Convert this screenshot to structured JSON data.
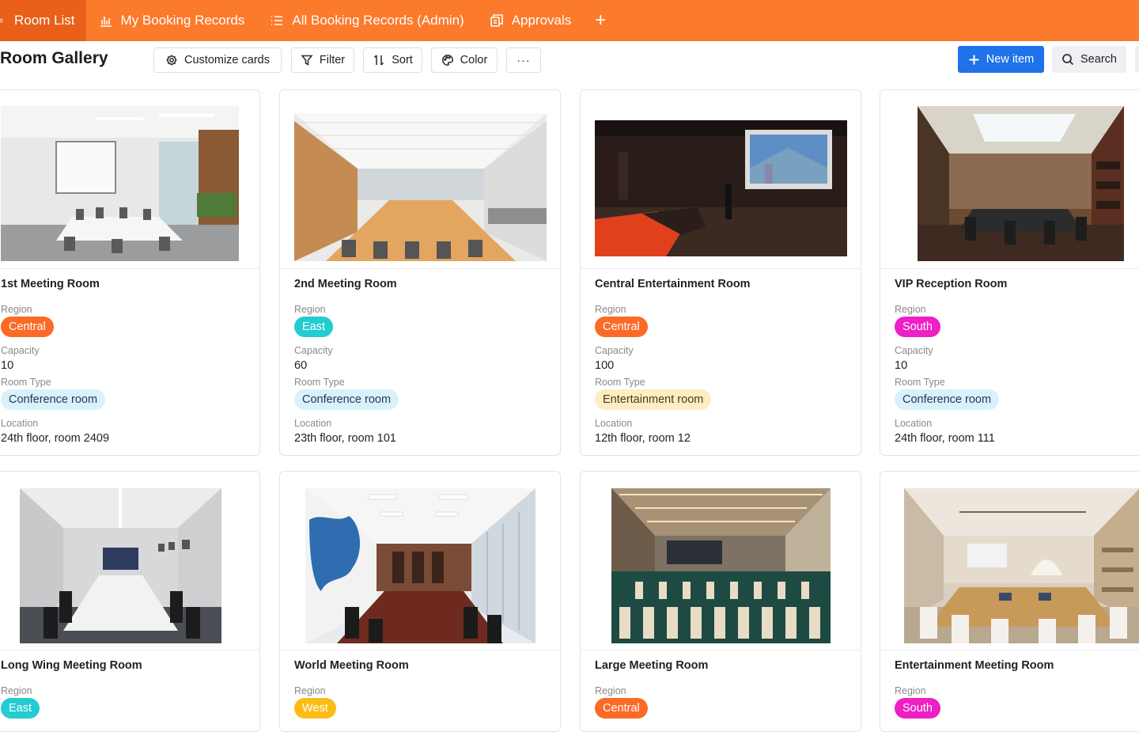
{
  "tabs": [
    {
      "label": "Room List",
      "icon": "menu-icon",
      "active": true
    },
    {
      "label": "My Booking Records",
      "icon": "bar-chart-icon",
      "active": false
    },
    {
      "label": "All Booking Records (Admin)",
      "icon": "list-icon",
      "active": false
    },
    {
      "label": "Approvals",
      "icon": "copy-icon",
      "active": false
    }
  ],
  "tab_add_label": "+",
  "toolbar": {
    "title": "Room Gallery",
    "customize_label": "Customize cards",
    "filter_label": "Filter",
    "sort_label": "Sort",
    "color_label": "Color",
    "more_label": "···",
    "new_item_label": "New item",
    "search_label": "Search"
  },
  "fields": {
    "region": "Region",
    "capacity": "Capacity",
    "room_type": "Room Type",
    "location": "Location"
  },
  "colors": {
    "accent_orange": "#fc7a2c",
    "primary_blue": "#1f72e8",
    "region_central": "#fb6a26",
    "region_east": "#23ccd1",
    "region_south": "#ee1fc5",
    "region_west": "#fcbc16",
    "type_conference_bg": "#d9f1fb",
    "type_entertainment_bg": "#fdedc3"
  },
  "cards": [
    {
      "title": "1st Meeting Room",
      "region": "Central",
      "capacity": "10",
      "room_type": "Conference room",
      "location": "24th floor, room 2409"
    },
    {
      "title": "2nd Meeting Room",
      "region": "East",
      "capacity": "60",
      "room_type": "Conference room",
      "location": "23th floor, room 101"
    },
    {
      "title": "Central Entertainment Room",
      "region": "Central",
      "capacity": "100",
      "room_type": "Entertainment room",
      "location": "12th floor, room 12"
    },
    {
      "title": "VIP Reception Room",
      "region": "South",
      "capacity": "10",
      "room_type": "Conference room",
      "location": "24th floor, room 111"
    },
    {
      "title": "Long Wing Meeting Room",
      "region": "East"
    },
    {
      "title": "World Meeting Room",
      "region": "West"
    },
    {
      "title": "Large Meeting Room",
      "region": "Central"
    },
    {
      "title": "Entertainment Meeting Room",
      "region": "South"
    }
  ]
}
